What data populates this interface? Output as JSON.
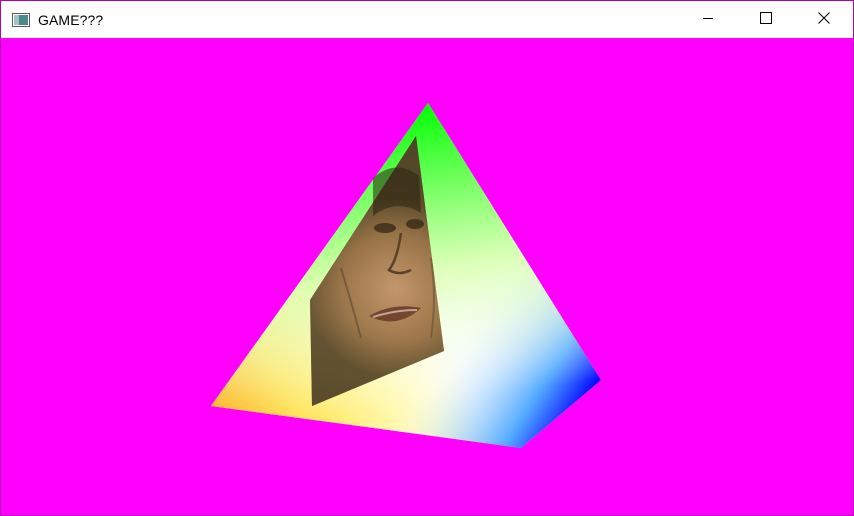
{
  "window": {
    "title": "GAME???",
    "icon": "app-window-icon"
  },
  "controls": {
    "minimize_icon": "minimize-icon",
    "maximize_icon": "maximize-icon",
    "close_icon": "close-icon"
  },
  "scene": {
    "background_color": "#ff00ff",
    "object": "rainbow-gradient-pyramid",
    "textured_face": "face-photo-texture",
    "vertex_colors": {
      "apex": "#00ff00",
      "left": "#ffa500",
      "right": "#0000ff",
      "front": "#ffffff"
    }
  }
}
